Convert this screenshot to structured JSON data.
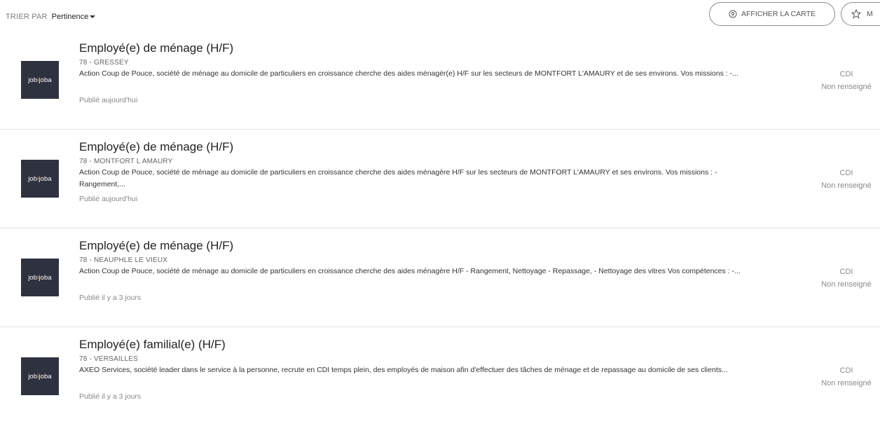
{
  "sort": {
    "label": "TRIER PAR",
    "value": "Pertinence"
  },
  "actions": {
    "map_label": "AFFICHER LA CARTE",
    "map_icon": "location-pin-icon",
    "save_label": "M",
    "save_icon": "star-icon"
  },
  "logo": {
    "text_before": "job",
    "text_dot": "i",
    "text_after": "joba"
  },
  "jobs": [
    {
      "title": "Employé(e) de ménage (H/F)",
      "location": "78 - GRESSEY",
      "description": "Action Coup de Pouce, société de ménage au domicile de particuliers en croissance cherche des aides ménagèr(e) H/F sur les secteurs de MONTFORT L'AMAURY et de ses environs. Vos missions : -...",
      "published": "Publié aujourd'hui",
      "contract": "CDI",
      "salary": "Non renseigné"
    },
    {
      "title": "Employé(e) de ménage (H/F)",
      "location": "78 - MONTFORT L AMAURY",
      "description": "Action Coup de Pouce, société de ménage au domicile de particuliers en croissance cherche des aides ménagère H/F sur les secteurs de MONTFORT L'AMAURY et ses environs. Vos missions : - Rangement,...",
      "published": "Publié aujourd'hui",
      "contract": "CDI",
      "salary": "Non renseigné"
    },
    {
      "title": "Employé(e) de ménage (H/F)",
      "location": "78 - NEAUPHLE LE VIEUX",
      "description": "Action Coup de Pouce, société de ménage au domicile de particuliers en croissance cherche des aides ménagère H/F - Rangement, Nettoyage - Repassage, - Nettoyage des vitres Vos compétences : -...",
      "published": "Publié il y a 3 jours",
      "contract": "CDI",
      "salary": "Non renseigné"
    },
    {
      "title": "Employé(e) familial(e) (H/F)",
      "location": "78 - VERSAILLES",
      "description": "AXEO Services, société leader dans le service à la personne, recrute en CDI temps plein, des employés de maison afin d'effectuer des tâches de ménage et de repassage au domicile de ses clients...",
      "published": "Publié il y a 3 jours",
      "contract": "CDI",
      "salary": "Non renseigné"
    }
  ]
}
